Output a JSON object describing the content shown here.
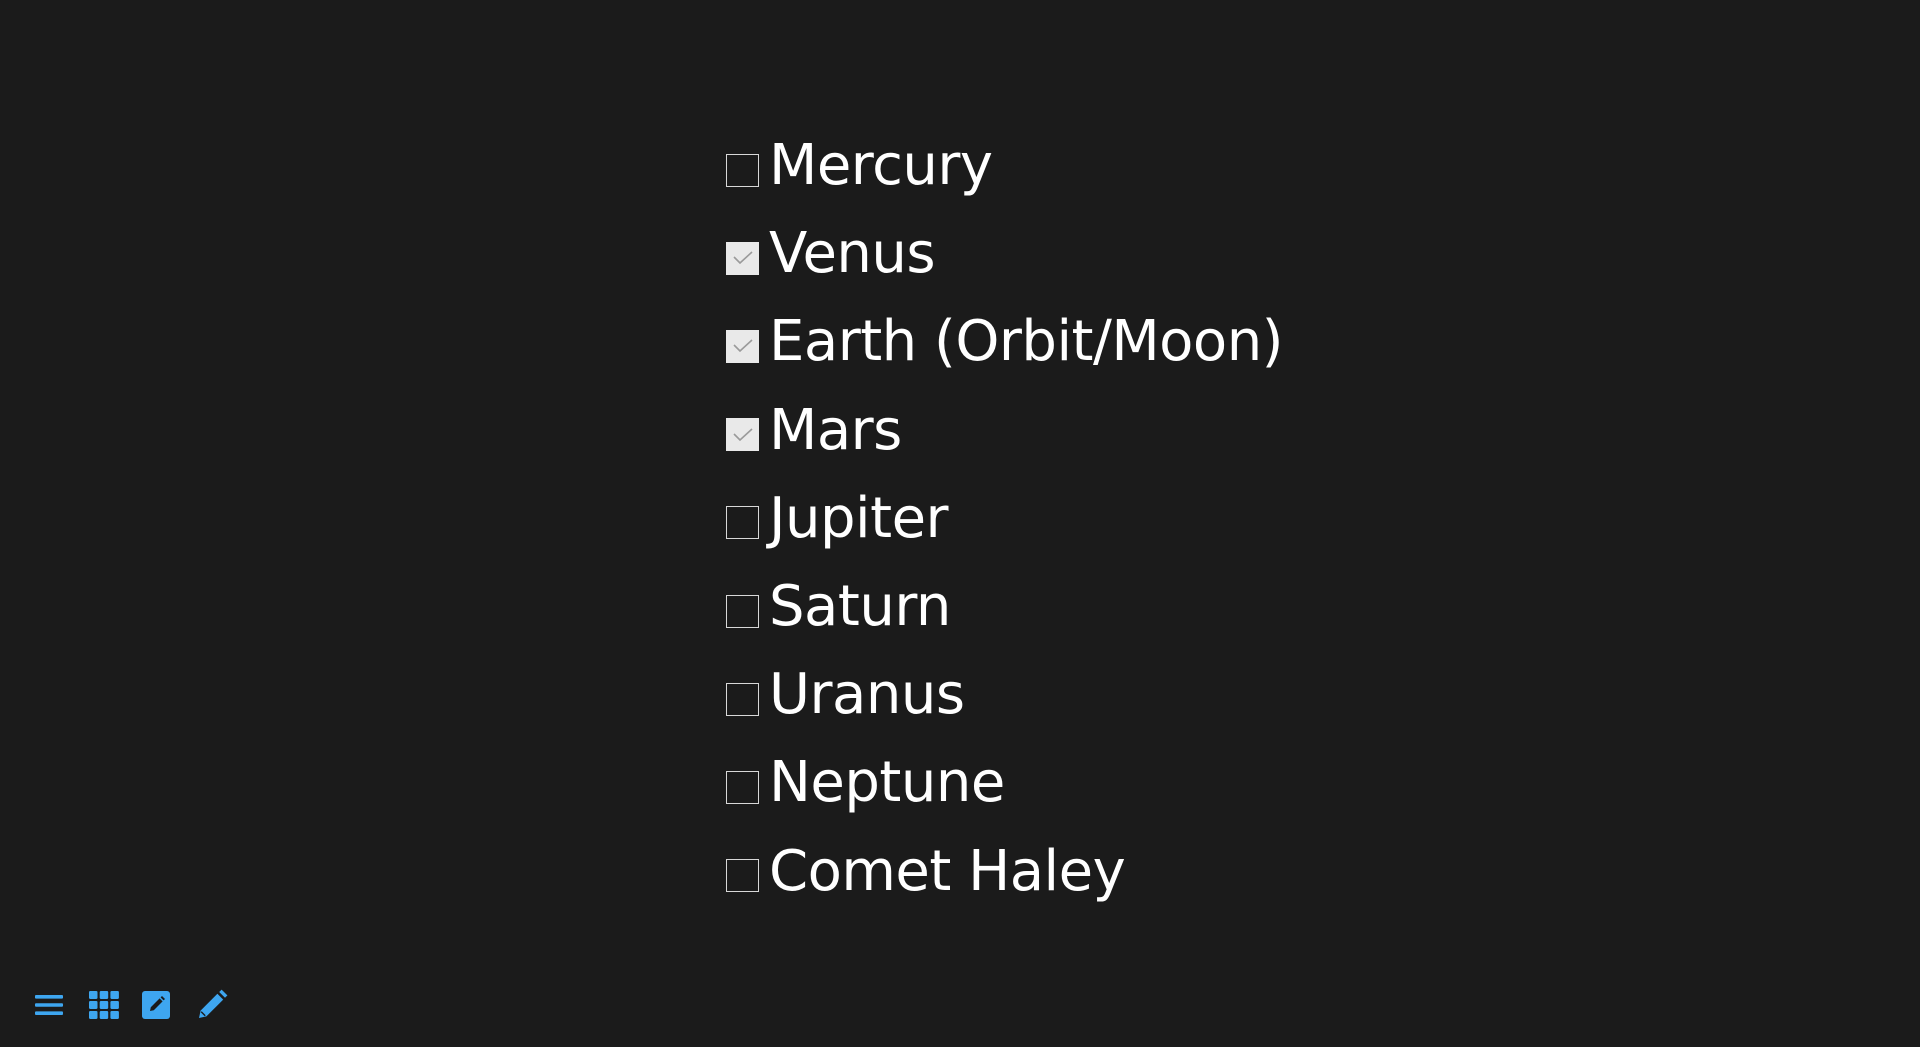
{
  "checklist": {
    "items": [
      {
        "label": "Mercury",
        "checked": false
      },
      {
        "label": "Venus",
        "checked": true
      },
      {
        "label": "Earth (Orbit/Moon)",
        "checked": true
      },
      {
        "label": "Mars",
        "checked": true
      },
      {
        "label": "Jupiter",
        "checked": false
      },
      {
        "label": "Saturn",
        "checked": false
      },
      {
        "label": "Uranus",
        "checked": false
      },
      {
        "label": "Neptune",
        "checked": false
      },
      {
        "label": "Comet Haley",
        "checked": false
      }
    ]
  },
  "toolbar": {
    "icons": [
      "list-icon",
      "grid-icon",
      "edit-square-icon",
      "pencil-icon"
    ]
  },
  "colors": {
    "background": "#1b1b1b",
    "text": "#ffffff",
    "accent": "#3ea6f0",
    "checkbox_border": "#d8d8d8",
    "checkbox_checked_fill": "#e9e9e9"
  }
}
